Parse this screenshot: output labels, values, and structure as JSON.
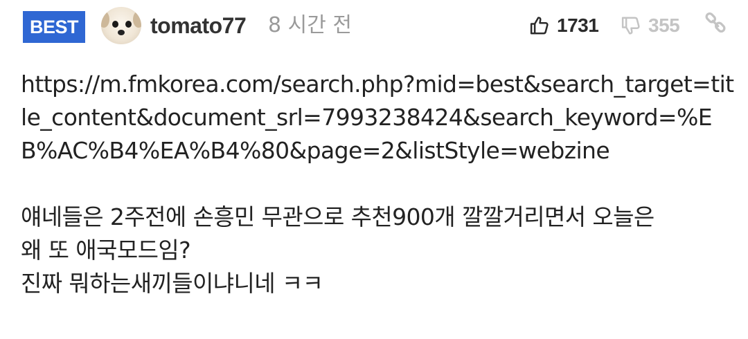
{
  "comment": {
    "badge": "BEST",
    "avatar_icon": "puppy-avatar",
    "username": "tomato77",
    "time": "8 시간 전",
    "upvotes": "1731",
    "downvotes": "355",
    "icons": {
      "upvote": "thumbs-up-icon",
      "downvote": "thumbs-down-icon",
      "link": "link-icon"
    },
    "body_url": "https://m.fmkorea.com/search.php?mid=best&search_target=title_content&document_srl=7993238424&search_keyword=%EB%AC%B4%EA%B4%80&page=2&listStyle=webzine",
    "body_lines": [
      "얘네들은 2주전에 손흥민 무관으로 추천900개 깔깔거리면서 오늘은",
      "왜 또 애국모드임?",
      "진짜 뭐하는새끼들이냐니네 ㅋㅋ"
    ]
  },
  "colors": {
    "badge_bg": "#2f67d3",
    "muted": "#9a9a9a",
    "downvote": "#c4c4c4"
  }
}
